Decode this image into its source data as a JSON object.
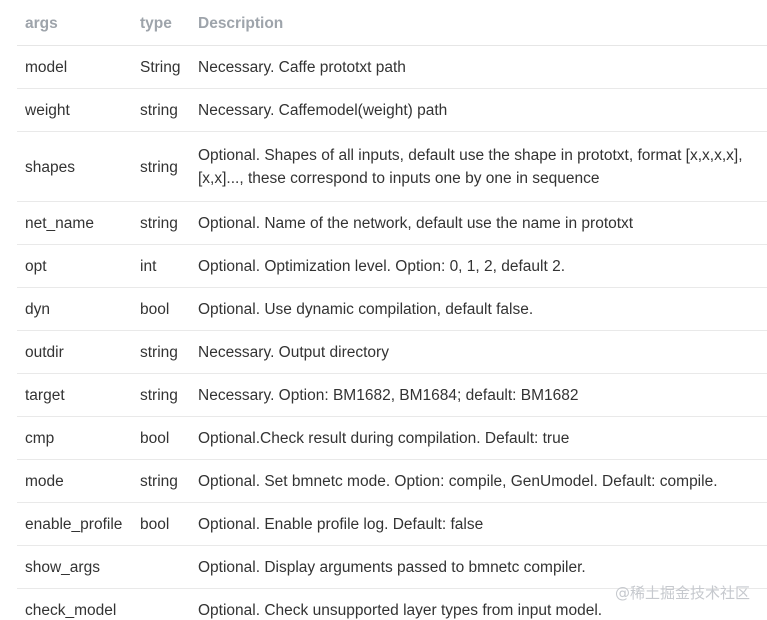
{
  "table": {
    "headers": [
      "args",
      "type",
      "Description"
    ],
    "rows": [
      {
        "arg": "model",
        "type": "String",
        "desc": "Necessary. Caffe prototxt path"
      },
      {
        "arg": "weight",
        "type": "string",
        "desc": "Necessary. Caffemodel(weight) path"
      },
      {
        "arg": "shapes",
        "type": "string",
        "desc": "Optional. Shapes of all inputs, default use the shape in prototxt, format [x,x,x,x],[x,x]..., these correspond to inputs one by one in sequence"
      },
      {
        "arg": "net_name",
        "type": "string",
        "desc": "Optional. Name of the network, default use the name in prototxt"
      },
      {
        "arg": "opt",
        "type": "int",
        "desc": "Optional. Optimization level. Option: 0, 1, 2, default 2."
      },
      {
        "arg": "dyn",
        "type": "bool",
        "desc": "Optional. Use dynamic compilation, default false."
      },
      {
        "arg": "outdir",
        "type": "string",
        "desc": "Necessary. Output directory"
      },
      {
        "arg": "target",
        "type": "string",
        "desc": "Necessary. Option: BM1682, BM1684; default: BM1682"
      },
      {
        "arg": "cmp",
        "type": "bool",
        "desc": "Optional.Check result during compilation. Default: true"
      },
      {
        "arg": "mode",
        "type": "string",
        "desc": "Optional. Set bmnetc mode. Option: compile, GenUmodel. Default: compile."
      },
      {
        "arg": "enable_profile",
        "type": "bool",
        "desc": "Optional. Enable profile log. Default: false"
      },
      {
        "arg": "show_args",
        "type": "",
        "desc": "Optional. Display arguments passed to bmnetc compiler."
      },
      {
        "arg": "check_model",
        "type": "",
        "desc": "Optional. Check unsupported layer types from input model."
      }
    ]
  },
  "watermark": "@稀土掘金技术社区"
}
